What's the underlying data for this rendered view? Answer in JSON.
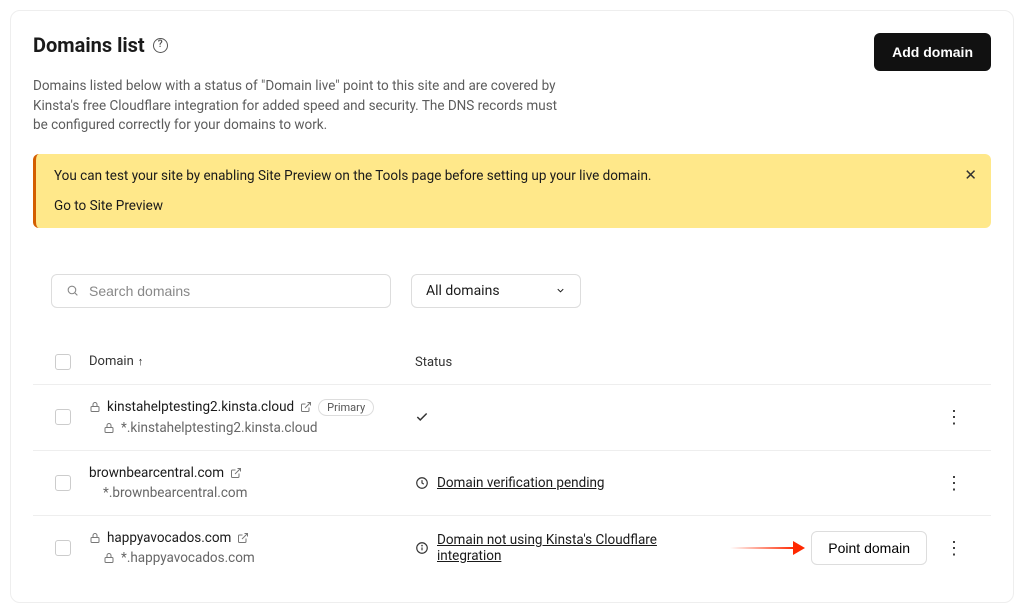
{
  "header": {
    "title": "Domains list",
    "subtext": "Domains listed below with a status of \"Domain live\" point to this site and are covered by Kinsta's free Cloudflare integration for added speed and security. The DNS records must be configured correctly for your domains to work.",
    "add_button": "Add domain"
  },
  "notice": {
    "text": "You can test your site by enabling Site Preview on the Tools page before setting up your live domain.",
    "link": "Go to Site Preview"
  },
  "search": {
    "placeholder": "Search domains"
  },
  "filter": {
    "label": "All domains"
  },
  "columns": {
    "domain": "Domain",
    "status": "Status"
  },
  "rows": [
    {
      "domain": "kinstahelptesting2.kinsta.cloud",
      "wildcard": "*.kinstahelptesting2.kinsta.cloud",
      "primary": true,
      "show_lock": true,
      "show_sub_lock": true,
      "status": "check"
    },
    {
      "domain": "brownbearcentral.com",
      "wildcard": "*.brownbearcentral.com",
      "primary": false,
      "show_lock": false,
      "show_sub_lock": false,
      "status": "pending",
      "status_text": "Domain verification pending"
    },
    {
      "domain": "happyavocados.com",
      "wildcard": "*.happyavocados.com",
      "primary": false,
      "show_lock": true,
      "show_sub_lock": true,
      "status": "warning",
      "status_text": "Domain not using Kinsta's Cloudflare integration",
      "action": "Point domain",
      "highlight_arrow": true
    }
  ],
  "badges": {
    "primary": "Primary"
  }
}
